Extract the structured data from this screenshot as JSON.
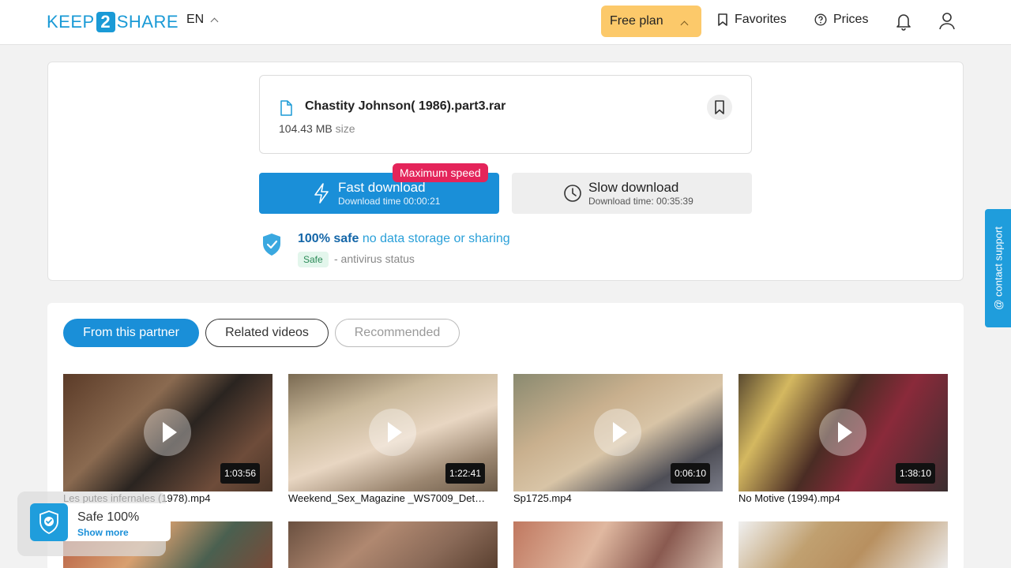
{
  "header": {
    "logo_left": "KEEP",
    "logo_mid": "2",
    "logo_right": "SHARE",
    "language": "EN",
    "plan_label": "Free plan",
    "favorites_label": "Favorites",
    "prices_label": "Prices"
  },
  "file": {
    "name": "Chastity Johnson( 1986).part3.rar",
    "size_value": "104.43 MB",
    "size_label": "size"
  },
  "download": {
    "fast_title": "Fast download",
    "fast_time": "Download time 00:00:21",
    "max_badge": "Maximum speed",
    "slow_title": "Slow download",
    "slow_time": "Download time: 00:35:39"
  },
  "safety": {
    "strong": "100% safe",
    "rest": "no data storage or sharing",
    "tag": "Safe",
    "status": "- antivirus status"
  },
  "support_label": "@ contact support",
  "tabs": {
    "partner": "From this partner",
    "related": "Related videos",
    "recommended": "Recommended"
  },
  "videos": [
    {
      "title": "Les putes infernales (1978).mp4",
      "duration": "1:03:56"
    },
    {
      "title": "Weekend_Sex_Magazine _WS7009_Det…",
      "duration": "1:22:41"
    },
    {
      "title": "Sp1725.mp4",
      "duration": "0:06:10"
    },
    {
      "title": "No Motive (1994).mp4",
      "duration": "1:38:10"
    }
  ],
  "safe_widget": {
    "title": "Safe 100%",
    "link": "Show more"
  },
  "colors": {
    "brand": "#1a9ad6",
    "fast_button": "#1a8fd8",
    "plan_button": "#fcc96a",
    "max_badge": "#e4245a"
  }
}
